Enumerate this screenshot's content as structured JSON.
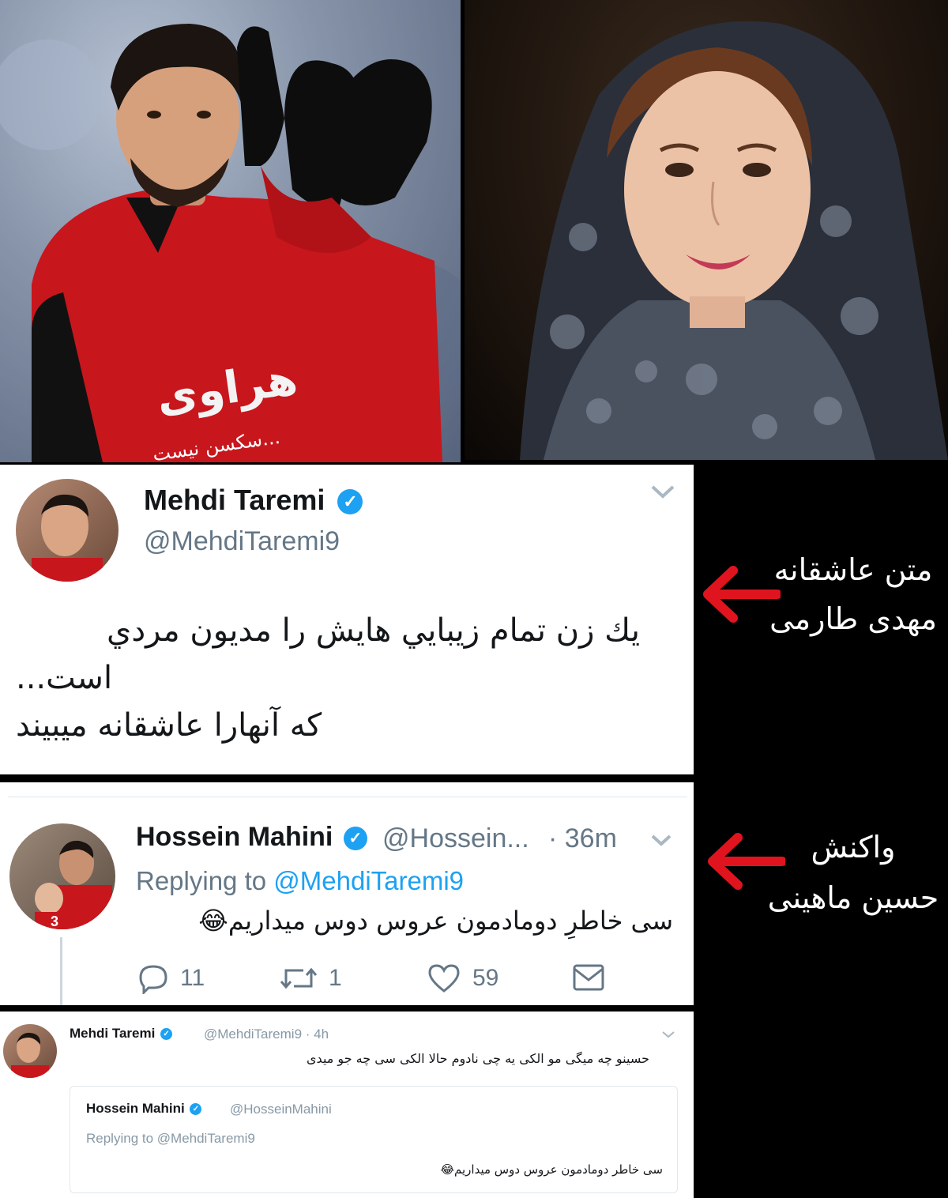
{
  "tweet_main": {
    "name": "Mehdi Taremi",
    "handle": "@MehdiTaremi9",
    "text_line1": "يك زن تمام زيبايي هايش را مديون مردي",
    "text_line2": "است...",
    "text_line3": "که آنهارا عاشقانه میبیند"
  },
  "reply": {
    "name": "Hossein Mahini",
    "handle": "@Hossein...",
    "time": "· 36m",
    "replying_prefix": "Replying to",
    "replying_handle": "@MehdiTaremi9",
    "text": "سی خاطرِ دومادمون عروس دوس میداریم😂",
    "counts": {
      "replies": "11",
      "retweets": "1",
      "likes": "59"
    }
  },
  "second_reply": {
    "name": "Mehdi Taremi",
    "handle": "@MehdiTaremi9 · 4h",
    "text": "حسینو چه میگی مو الکی یه چی نادوم حالا الکی سی چه جو میدی",
    "quoted": {
      "name": "Hossein Mahini",
      "handle": "@HosseinMahini",
      "replying": "Replying to @MehdiTaremi9",
      "text": "سی خاطر دومادمون عروس دوس میداریم😂"
    }
  },
  "captions": {
    "first_line1": "متن عاشقانه",
    "first_line2": "مهدی طارمی",
    "second_line1": "واکنش",
    "second_line2": "حسین ماهینی"
  },
  "photo_left": {
    "jersey_text": "سکسن نیست..."
  },
  "colors": {
    "accent": "#1da1f2",
    "arrow": "#e0141e",
    "jersey": "#c8161d"
  }
}
